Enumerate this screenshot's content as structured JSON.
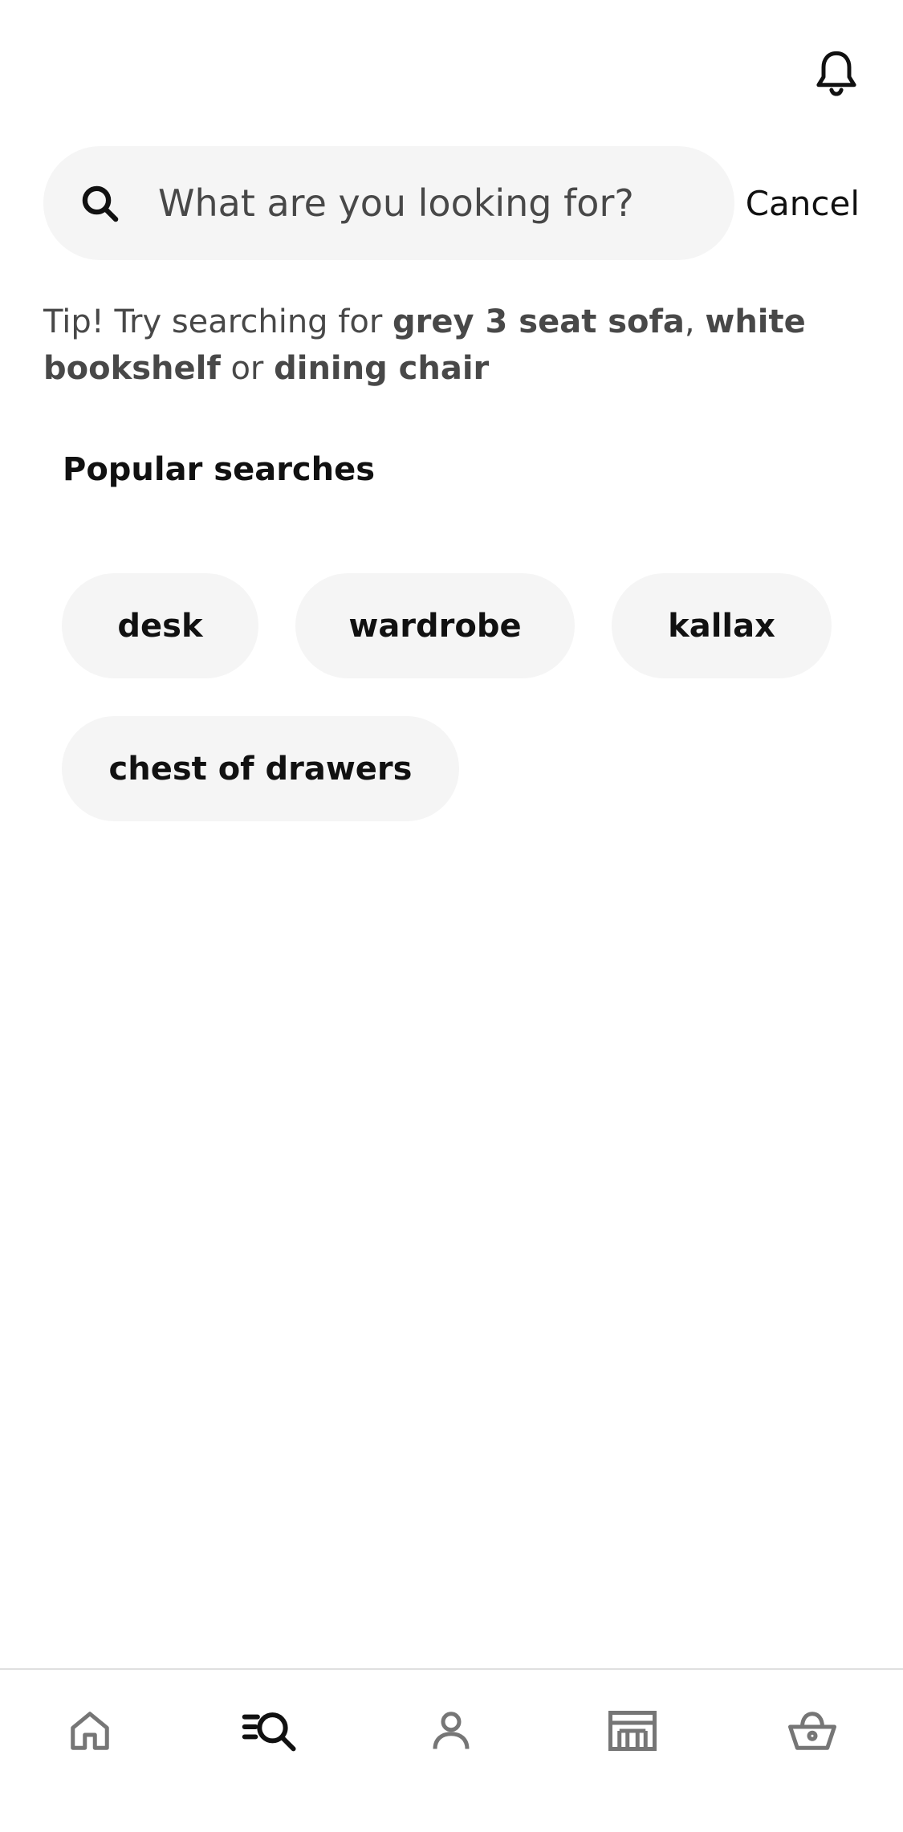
{
  "header": {
    "bell_icon": "bell-icon"
  },
  "search": {
    "placeholder": "What are you looking for?",
    "cancel_label": "Cancel",
    "icon": "search-icon"
  },
  "tip": {
    "prefix": "Tip! Try searching for",
    "term_1": "grey 3 seat sofa",
    "sep_1": ",",
    "term_2": "white bookshelf",
    "sep_2": "or",
    "term_3": "dining chair"
  },
  "popular": {
    "title": "Popular searches",
    "chips": [
      "desk",
      "wardrobe",
      "kallax",
      "chest of drawers"
    ]
  },
  "bottom_nav": {
    "items": [
      {
        "icon": "home-icon",
        "active": false
      },
      {
        "icon": "search-list-icon",
        "active": true
      },
      {
        "icon": "profile-icon",
        "active": false
      },
      {
        "icon": "store-icon",
        "active": false
      },
      {
        "icon": "basket-icon",
        "active": false
      }
    ],
    "active_color": "#111111",
    "inactive_color": "#767676"
  },
  "colors": {
    "chip_background": "#f5f5f5",
    "text_primary": "#111111",
    "text_secondary": "#484848"
  }
}
